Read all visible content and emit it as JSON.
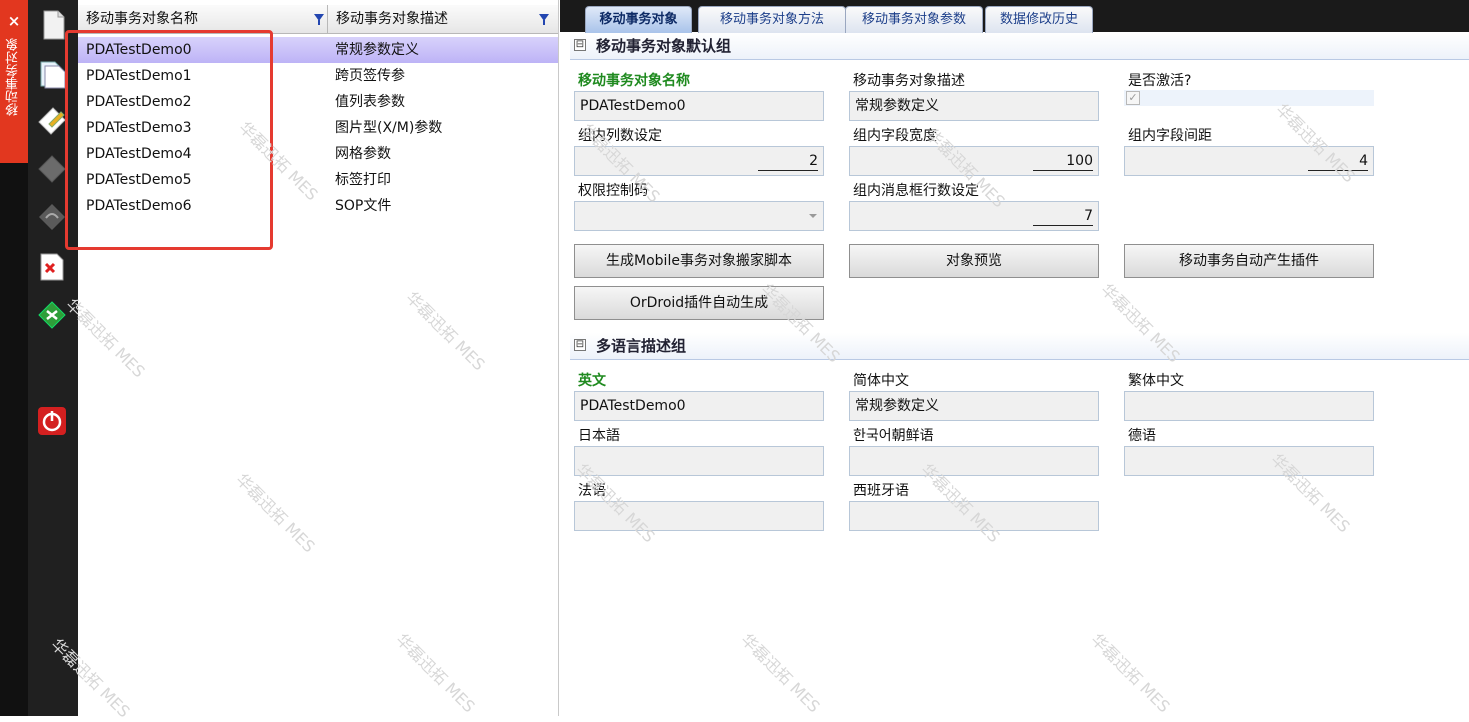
{
  "side_tab": {
    "close": "×",
    "label": "移动事务对象"
  },
  "list": {
    "columns": [
      "移动事务对象名称",
      "移动事务对象描述"
    ],
    "rows": [
      {
        "name": "PDATestDemo0",
        "desc": "常规参数定义"
      },
      {
        "name": "PDATestDemo1",
        "desc": "跨页签传参"
      },
      {
        "name": "PDATestDemo2",
        "desc": "值列表参数"
      },
      {
        "name": "PDATestDemo3",
        "desc": "图片型(X/M)参数"
      },
      {
        "name": "PDATestDemo4",
        "desc": "网格参数"
      },
      {
        "name": "PDATestDemo5",
        "desc": "标签打印"
      },
      {
        "name": "PDATestDemo6",
        "desc": "SOP文件"
      }
    ]
  },
  "tabs": [
    "移动事务对象",
    "移动事务对象方法",
    "移动事务对象参数",
    "数据修改历史"
  ],
  "group1": {
    "title": "移动事务对象默认组",
    "toggle": "⊟",
    "name_label": "移动事务对象名称",
    "name_value": "PDATestDemo0",
    "desc_label": "移动事务对象描述",
    "desc_value": "常规参数定义",
    "active_label": "是否激活?",
    "active_check": "✓",
    "cols_label": "组内列数设定",
    "cols_value": "2",
    "width_label": "组内字段宽度",
    "width_value": "100",
    "spacing_label": "组内字段间距",
    "spacing_value": "4",
    "perm_label": "权限控制码",
    "rows_label": "组内消息框行数设定",
    "rows_value": "7",
    "btn_script": "生成Mobile事务对象搬家脚本",
    "btn_preview": "对象预览",
    "btn_plugin": "移动事务自动产生插件",
    "btn_ordroid": "OrDroid插件自动生成"
  },
  "group2": {
    "title": "多语言描述组",
    "toggle": "⊟",
    "en_label": "英文",
    "en_value": "PDATestDemo0",
    "zh_label": "简体中文",
    "zh_value": "常规参数定义",
    "tw_label": "繁体中文",
    "ja_label": "日本語",
    "ko_label": "한국어朝鲜语",
    "de_label": "德语",
    "fr_label": "法语",
    "es_label": "西班牙语"
  },
  "watermark": "华磊迅拓 MES",
  "colors": {
    "side_tab": "#e2371f",
    "selected_row": "#c8c0f8",
    "annotation": "#e53a30",
    "label_green": "#1f8a1f"
  }
}
